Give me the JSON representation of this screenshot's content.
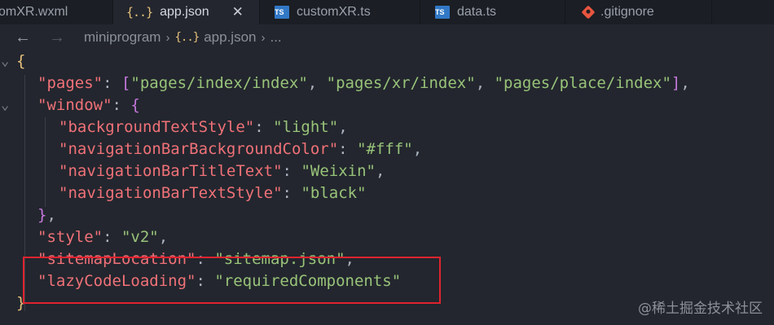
{
  "tabs": [
    {
      "label": "omXR.wxml",
      "icon": "none",
      "active": false
    },
    {
      "label": "app.json",
      "icon": "json-icon",
      "active": true
    },
    {
      "label": "customXR.ts",
      "icon": "ts-icon",
      "active": false
    },
    {
      "label": "data.ts",
      "icon": "ts-icon",
      "active": false
    },
    {
      "label": ".gitignore",
      "icon": "git-icon",
      "active": false
    }
  ],
  "tab_close_glyph": "✕",
  "ts_badge": "TS",
  "json_badge": "{..}",
  "breadcrumb": {
    "folder": "miniprogram",
    "file": "app.json",
    "more": "..."
  },
  "code_lines": [
    [
      {
        "t": "{",
        "c": "b1"
      }
    ],
    [
      {
        "t": "\"pages\"",
        "c": "k"
      },
      {
        "t": ": ",
        "c": "p"
      },
      {
        "t": "[",
        "c": "b2"
      },
      {
        "t": "\"pages/index/index\"",
        "c": "s"
      },
      {
        "t": ", ",
        "c": "p"
      },
      {
        "t": "\"pages/xr/index\"",
        "c": "s"
      },
      {
        "t": ", ",
        "c": "p"
      },
      {
        "t": "\"pages/place/index\"",
        "c": "s"
      },
      {
        "t": "]",
        "c": "b2"
      },
      {
        "t": ",",
        "c": "p"
      }
    ],
    [
      {
        "t": "\"window\"",
        "c": "k"
      },
      {
        "t": ": ",
        "c": "p"
      },
      {
        "t": "{",
        "c": "b2"
      }
    ],
    [
      {
        "t": "\"backgroundTextStyle\"",
        "c": "k"
      },
      {
        "t": ": ",
        "c": "p"
      },
      {
        "t": "\"light\"",
        "c": "s"
      },
      {
        "t": ",",
        "c": "p"
      }
    ],
    [
      {
        "t": "\"navigationBarBackgroundColor\"",
        "c": "k"
      },
      {
        "t": ": ",
        "c": "p"
      },
      {
        "t": "\"#fff\"",
        "c": "s"
      },
      {
        "t": ",",
        "c": "p"
      }
    ],
    [
      {
        "t": "\"navigationBarTitleText\"",
        "c": "k"
      },
      {
        "t": ": ",
        "c": "p"
      },
      {
        "t": "\"Weixin\"",
        "c": "s"
      },
      {
        "t": ",",
        "c": "p"
      }
    ],
    [
      {
        "t": "\"navigationBarTextStyle\"",
        "c": "k"
      },
      {
        "t": ": ",
        "c": "p"
      },
      {
        "t": "\"black\"",
        "c": "s"
      }
    ],
    [
      {
        "t": "}",
        "c": "b2"
      },
      {
        "t": ",",
        "c": "p"
      }
    ],
    [
      {
        "t": "\"style\"",
        "c": "k"
      },
      {
        "t": ": ",
        "c": "p"
      },
      {
        "t": "\"v2\"",
        "c": "s"
      },
      {
        "t": ",",
        "c": "p"
      }
    ],
    [
      {
        "t": "\"sitemapLocation\"",
        "c": "k"
      },
      {
        "t": ": ",
        "c": "p"
      },
      {
        "t": "\"sitemap.json\"",
        "c": "s"
      },
      {
        "t": ",",
        "c": "p"
      }
    ],
    [
      {
        "t": "\"lazyCodeLoading\"",
        "c": "k"
      },
      {
        "t": ": ",
        "c": "p"
      },
      {
        "t": "\"requiredComponents\"",
        "c": "s"
      }
    ],
    [
      {
        "t": "}",
        "c": "b1"
      }
    ]
  ],
  "watermark": "@稀土掘金技术社区",
  "colors": {
    "background": "#23262e",
    "key": "#f07178",
    "string": "#98c379",
    "highlight_box": "#e0232f"
  }
}
